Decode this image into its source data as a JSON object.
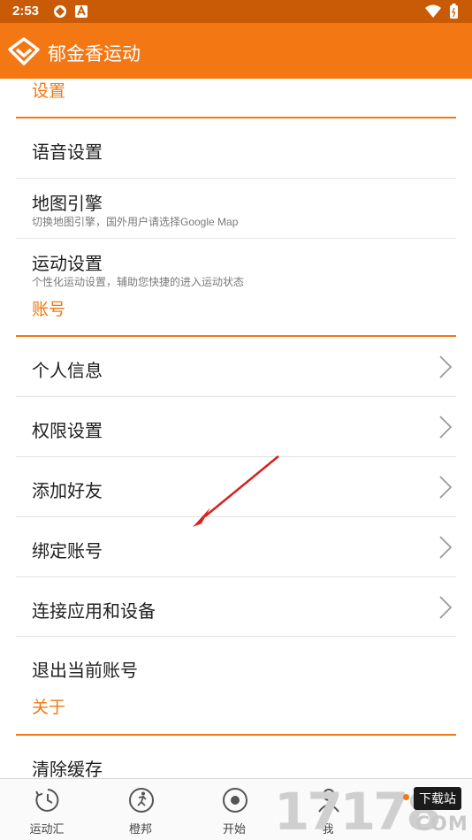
{
  "status_bar": {
    "time": "2:53",
    "icons": [
      "app-icon",
      "a-icon",
      "wifi-icon",
      "battery-icon"
    ]
  },
  "app_bar": {
    "title": "郁金香运动",
    "accent": "#f37712"
  },
  "settings": {
    "section_settings": "设置",
    "voice_settings": "语音设置",
    "map_engine": {
      "title": "地图引擎",
      "subtitle": "切换地图引擎，国外用户请选择Google Map"
    },
    "sport_settings": {
      "title": "运动设置",
      "subtitle": "个性化运动设置，辅助您快捷的进入运动状态"
    },
    "section_account": "账号",
    "personal_info": "个人信息",
    "permissions": "权限设置",
    "add_friend": "添加好友",
    "bind_account": "绑定账号",
    "connect_apps": "连接应用和设备",
    "logout": "退出当前账号",
    "section_about": "关于",
    "clear_cache": "清除缓存"
  },
  "bottom_nav": {
    "items": [
      {
        "label": "运动汇",
        "icon": "history-icon"
      },
      {
        "label": "橙邦",
        "icon": "runner-icon"
      },
      {
        "label": "开始",
        "icon": "record-icon"
      },
      {
        "label": "我",
        "icon": "person-icon"
      }
    ]
  },
  "watermark": {
    "number": "17178",
    "badge": "下载站",
    "domain": "COM"
  }
}
